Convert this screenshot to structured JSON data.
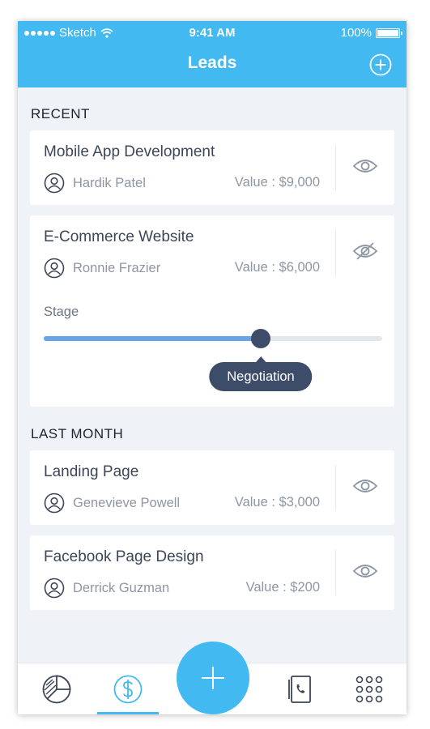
{
  "status_bar": {
    "carrier": "Sketch",
    "time": "9:41 AM",
    "battery": "100%"
  },
  "header": {
    "title": "Leads",
    "add_icon": "plus-circle-icon"
  },
  "sections": [
    {
      "label": "RECENT",
      "leads": [
        {
          "title": "Mobile App Development",
          "person": "Hardik Patel",
          "value": "Value : $9,000",
          "visibility": "eye-icon"
        },
        {
          "title": "E-Commerce Website",
          "person": "Ronnie Frazier",
          "value": "Value : $6,000",
          "visibility": "eye-off-icon",
          "stage": {
            "label": "Stage",
            "value": "Negotiation",
            "progress": 0.64
          }
        }
      ]
    },
    {
      "label": "LAST MONTH",
      "leads": [
        {
          "title": "Landing Page",
          "person": "Genevieve Powell",
          "value": "Value : $3,000",
          "visibility": "eye-icon"
        },
        {
          "title": "Facebook Page Design",
          "person": "Derrick Guzman",
          "value": "Value : $200",
          "visibility": "eye-icon"
        }
      ]
    }
  ],
  "tabbar": {
    "items": [
      "pie-chart-icon",
      "dollar-icon",
      "plus-icon",
      "phone-contact-icon",
      "grid-icon"
    ],
    "active": "dollar-icon"
  },
  "colors": {
    "primary": "#42b9f1",
    "dark": "#3d4c68",
    "slider_fill": "#67a4ea",
    "background": "#eff3f8"
  }
}
